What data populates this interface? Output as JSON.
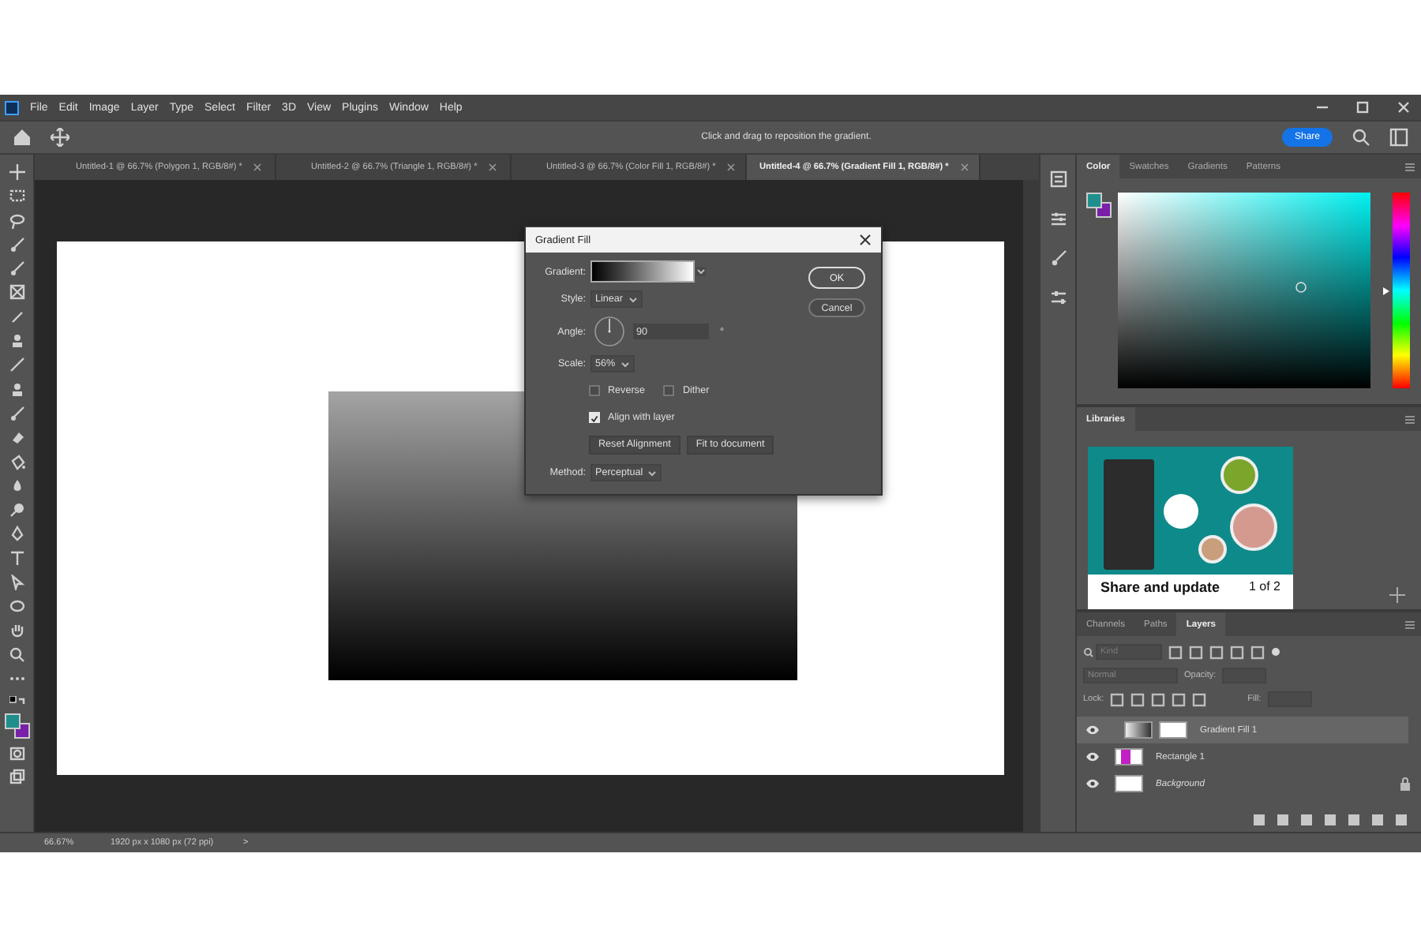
{
  "menu_bar": {
    "items": [
      "File",
      "Edit",
      "Image",
      "Layer",
      "Type",
      "Select",
      "Filter",
      "3D",
      "View",
      "Plugins",
      "Window",
      "Help"
    ]
  },
  "options_bar": {
    "hint": "Click and drag to reposition the gradient.",
    "share_button": "Share"
  },
  "document_tabs": [
    {
      "label": "Untitled-1 @ 66.7% (Polygon 1, RGB/8#) *",
      "selected": false
    },
    {
      "label": "Untitled-2 @ 66.7% (Triangle 1, RGB/8#) *",
      "selected": false
    },
    {
      "label": "Untitled-3 @ 66.7% (Color Fill 1, RGB/8#) *",
      "selected": false
    },
    {
      "label": "Untitled-4 @ 66.7% (Gradient Fill 1, RGB/8#) *",
      "selected": true
    }
  ],
  "gradient_dialog": {
    "title": "Gradient Fill",
    "gradient_label": "Gradient:",
    "style_label": "Style:",
    "style_value": "Linear",
    "angle_label": "Angle:",
    "angle_value": "90",
    "angle_unit": "°",
    "scale_label": "Scale:",
    "scale_value": "56%",
    "checkboxes": [
      {
        "label": "Reverse",
        "checked": false
      },
      {
        "label": "Dither",
        "checked": false
      },
      {
        "label": "Align with layer",
        "checked": true
      }
    ],
    "buttons": [
      "Reset Alignment",
      "Fit to document"
    ],
    "method_label": "Method:",
    "method_value": "Perceptual",
    "ok_button": "OK",
    "cancel_button": "Cancel"
  },
  "color_panel": {
    "hue_slider": {
      "level": 0.5
    },
    "tabs": [
      {
        "label": "Color",
        "selected": true
      },
      {
        "label": "Swatches",
        "selected": false
      },
      {
        "label": "Gradients",
        "selected": false
      },
      {
        "label": "Patterns",
        "selected": false
      }
    ]
  },
  "libraries_panel": {
    "title": "Libraries",
    "card_title": "Share and update",
    "card_counter": "1 of 2"
  },
  "layers_panel": {
    "tabs": [
      {
        "label": "Channels",
        "selected": false
      },
      {
        "label": "Paths",
        "selected": false
      },
      {
        "label": "Layers",
        "selected": true
      }
    ],
    "search_placeholder": "Kind",
    "blend_mode": "Normal",
    "opacity_label": "Opacity:",
    "lock_label": "Lock:",
    "fill_label": "Fill:",
    "layers": [
      {
        "name": "Gradient Fill 1",
        "kind": "gradient",
        "selected": true,
        "visible": true,
        "locked": false
      },
      {
        "name": "Rectangle 1",
        "kind": "shape",
        "selected": false,
        "visible": true,
        "locked": false
      },
      {
        "name": "Background",
        "kind": "background",
        "selected": false,
        "visible": true,
        "locked": true
      }
    ]
  },
  "status_bar": {
    "zoom": "66.67%",
    "document_size": "1920 px x 1080 px (72 ppi)",
    "arrow": ">"
  }
}
